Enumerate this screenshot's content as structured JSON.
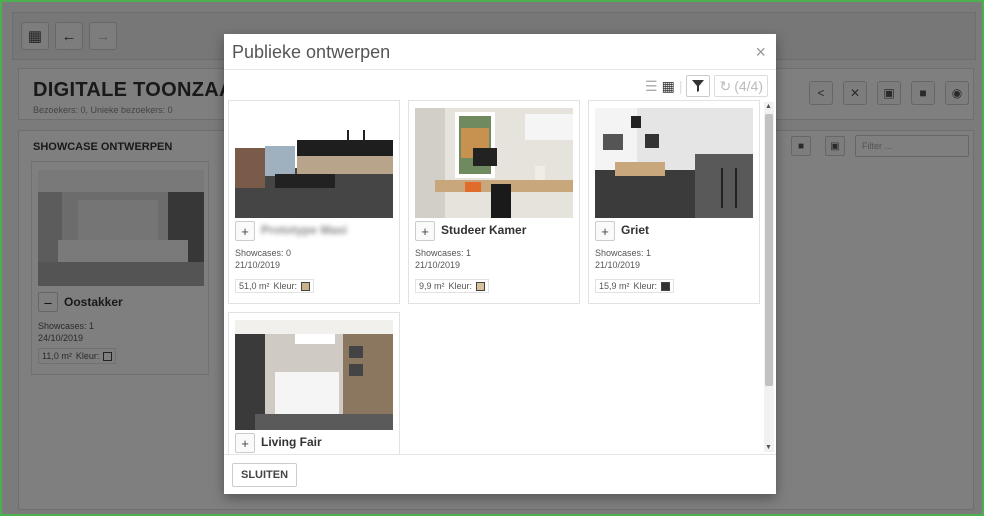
{
  "app": {
    "title": "DIGITALE TOONZAAL",
    "visitors": "Bezoekers: 0, Unieke bezoekers: 0",
    "panel_title": "SHOWCASE ONTWERPEN",
    "filter_placeholder": "Filter ..."
  },
  "showcase": {
    "name": "Oostakker",
    "showcases": "Showcases: 1",
    "date": "24/10/2019",
    "area": "11,0 m²",
    "color_label": "Kleur:",
    "color": "#ffffff"
  },
  "modal": {
    "title": "Publieke ontwerpen",
    "close": "×",
    "refresh_count": "(4/4)",
    "close_button": "SLUITEN",
    "cards": [
      {
        "name": "Prototype Maxi",
        "blurred": true,
        "showcases": "Showcases: 0",
        "date": "21/10/2019",
        "area": "51,0 m²",
        "color_label": "Kleur:",
        "color": "#c8b28a",
        "image": "kitchen-dark-render"
      },
      {
        "name": "Studeer Kamer",
        "blurred": false,
        "showcases": "Showcases: 1",
        "date": "21/10/2019",
        "area": "9,9 m²",
        "color_label": "Kleur:",
        "color": "#d7c09a",
        "image": "study-room-render"
      },
      {
        "name": "Griet",
        "blurred": false,
        "showcases": "Showcases: 1",
        "date": "21/10/2019",
        "area": "15,9 m²",
        "color_label": "Kleur:",
        "color": "#333333",
        "image": "kitchen-grey-render"
      },
      {
        "name": "Living Fair",
        "blurred": false,
        "showcases": "",
        "date": "",
        "area": "",
        "color_label": "",
        "color": "",
        "image": "kitchen-island-render"
      }
    ]
  },
  "colors": {
    "accent_border": "#4caf50",
    "overlay": "rgba(0,0,0,0.5)"
  }
}
